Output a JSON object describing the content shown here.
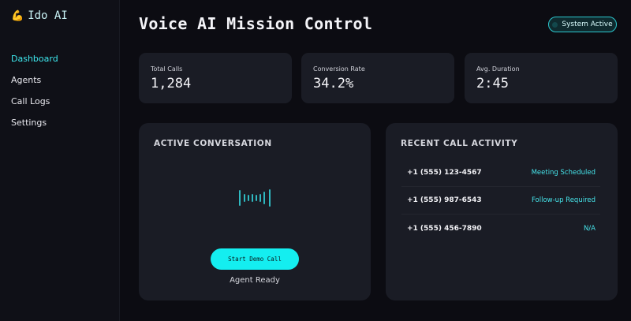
{
  "brand": {
    "logo_icon": "arm-icon",
    "name": "Ido AI"
  },
  "sidebar": {
    "items": [
      {
        "label": "Dashboard",
        "active": true
      },
      {
        "label": "Agents"
      },
      {
        "label": "Call Logs"
      },
      {
        "label": "Settings"
      }
    ]
  },
  "header": {
    "title": "Voice AI Mission Control",
    "status_label": "System Active"
  },
  "stats": [
    {
      "label": "Total Calls",
      "value": "1,284"
    },
    {
      "label": "Conversion Rate",
      "value": "34.2%"
    },
    {
      "label": "Avg. Duration",
      "value": "2:45"
    }
  ],
  "active_conversation": {
    "heading": "ACTIVE CONVERSATION",
    "button_label": "Start Demo Call",
    "status": "Agent Ready"
  },
  "recent_activity": {
    "heading": "RECENT CALL ACTIVITY",
    "calls": [
      {
        "number": "+1 (555) 123-4567",
        "status": "Meeting Scheduled"
      },
      {
        "number": "+1 (555) 987-6543",
        "status": "Follow-up Required"
      },
      {
        "number": "+1 (555) 456-7890",
        "status": "N/A"
      }
    ]
  },
  "colors": {
    "accent": "#14eef0",
    "panel": "#1a1c25",
    "background": "#0c0c12"
  }
}
